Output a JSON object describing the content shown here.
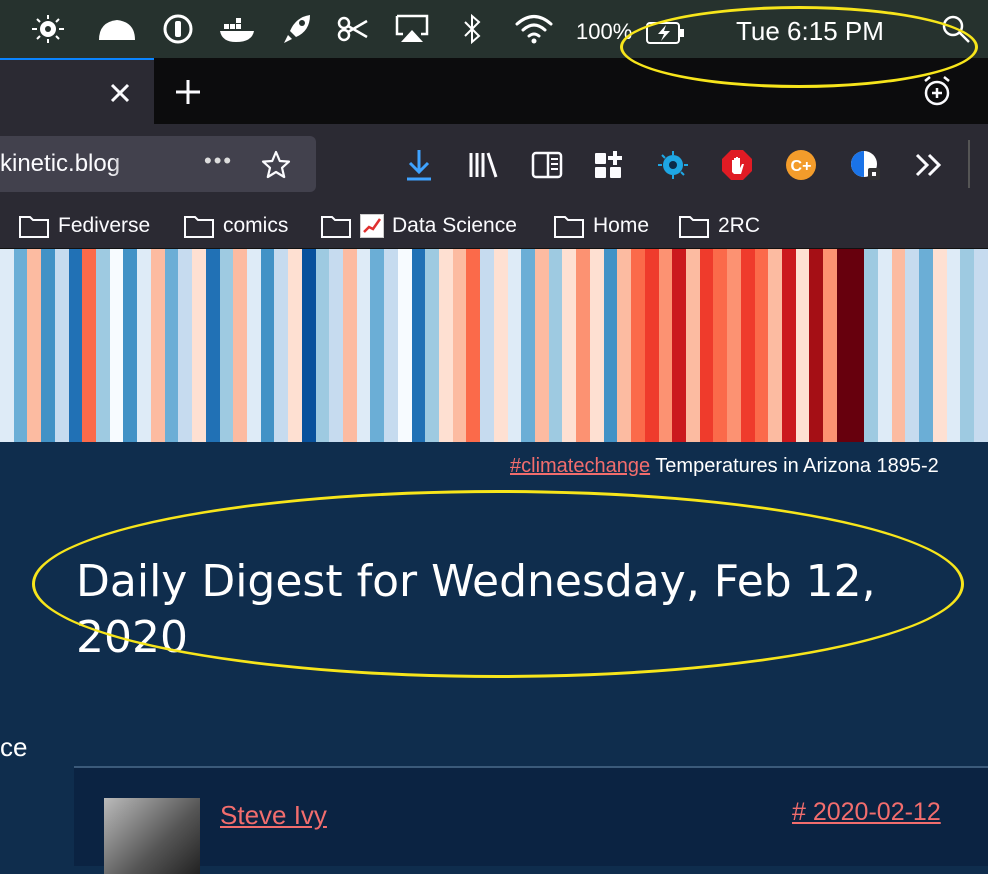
{
  "menubar": {
    "battery_percent": "100%",
    "clock": "Tue 6:15 PM",
    "icons": [
      "eye-icon",
      "cloud-icon",
      "onepassword-icon",
      "docker-icon",
      "rocket-icon",
      "scissors-icon",
      "airplay-icon",
      "bluetooth-icon",
      "wifi-icon",
      "battery-charging-icon",
      "spotlight-search-icon"
    ]
  },
  "tabbar": {
    "close_glyph": "✕",
    "new_tab_glyph": "+"
  },
  "navbar": {
    "url_text": "kinetic.blog",
    "page_actions": "•••",
    "extension_icons": [
      "download-icon",
      "library-icon",
      "reader-view-icon",
      "extensions-grid-icon",
      "eye-extension-icon",
      "adblock-icon",
      "coupon-icon",
      "privacy-badger-icon",
      "overflow-chevron-icon"
    ]
  },
  "bookmarks": [
    {
      "label": "Fediverse"
    },
    {
      "label": "comics"
    },
    {
      "label": "Data Science"
    },
    {
      "label": "Home"
    },
    {
      "label": "2RC"
    }
  ],
  "stripes_colors": [
    "#deebf7",
    "#6baed6",
    "#fcbba1",
    "#4292c6",
    "#c6dbef",
    "#2171b5",
    "#fb6a4a",
    "#9ecae1",
    "#f7fbff",
    "#4292c6",
    "#deebf7",
    "#fcbba1",
    "#6baed6",
    "#c6dbef",
    "#fee0d2",
    "#2171b5",
    "#9ecae1",
    "#fcbba1",
    "#deebf7",
    "#4292c6",
    "#c6dbef",
    "#fee0d2",
    "#08519c",
    "#9ecae1",
    "#c6dbef",
    "#fcbba1",
    "#deebf7",
    "#6baed6",
    "#c6dbef",
    "#f7fbff",
    "#2171b5",
    "#9ecae1",
    "#fee0d2",
    "#fcbba1",
    "#fb6a4a",
    "#c6dbef",
    "#fee0d2",
    "#deebf7",
    "#6baed6",
    "#fcbba1",
    "#9ecae1",
    "#fee0d2",
    "#fc9272",
    "#fee0d2",
    "#4292c6",
    "#fcbba1",
    "#fb6a4a",
    "#ef3b2c",
    "#fc9272",
    "#cb181d",
    "#fcbba1",
    "#ef3b2c",
    "#fb6a4a",
    "#fc9272",
    "#ef3b2c",
    "#fb6a4a",
    "#fcbba1",
    "#cb181d",
    "#fee0d2",
    "#a50f15",
    "#fc9272",
    "#67000d",
    "#67000d",
    "#9ecae1",
    "#deebf7",
    "#fcbba1",
    "#c6dbef",
    "#6baed6",
    "#fee0d2",
    "#deebf7",
    "#9ecae1",
    "#c6dbef"
  ],
  "page": {
    "caption_tag": "#climatechange",
    "caption_text": " Temperatures in Arizona 1895-2",
    "headline": "Daily Digest for Wednesday, Feb 12, 2020",
    "sidebar_fragment": "ce",
    "post": {
      "author": "Steve Ivy",
      "permalink": "# 2020-02-12"
    }
  },
  "colors": {
    "page_bg": "#0f2d4d",
    "link": "#f26d6d",
    "annotation": "#f7e51b",
    "tab_accent": "#0a84ff"
  }
}
